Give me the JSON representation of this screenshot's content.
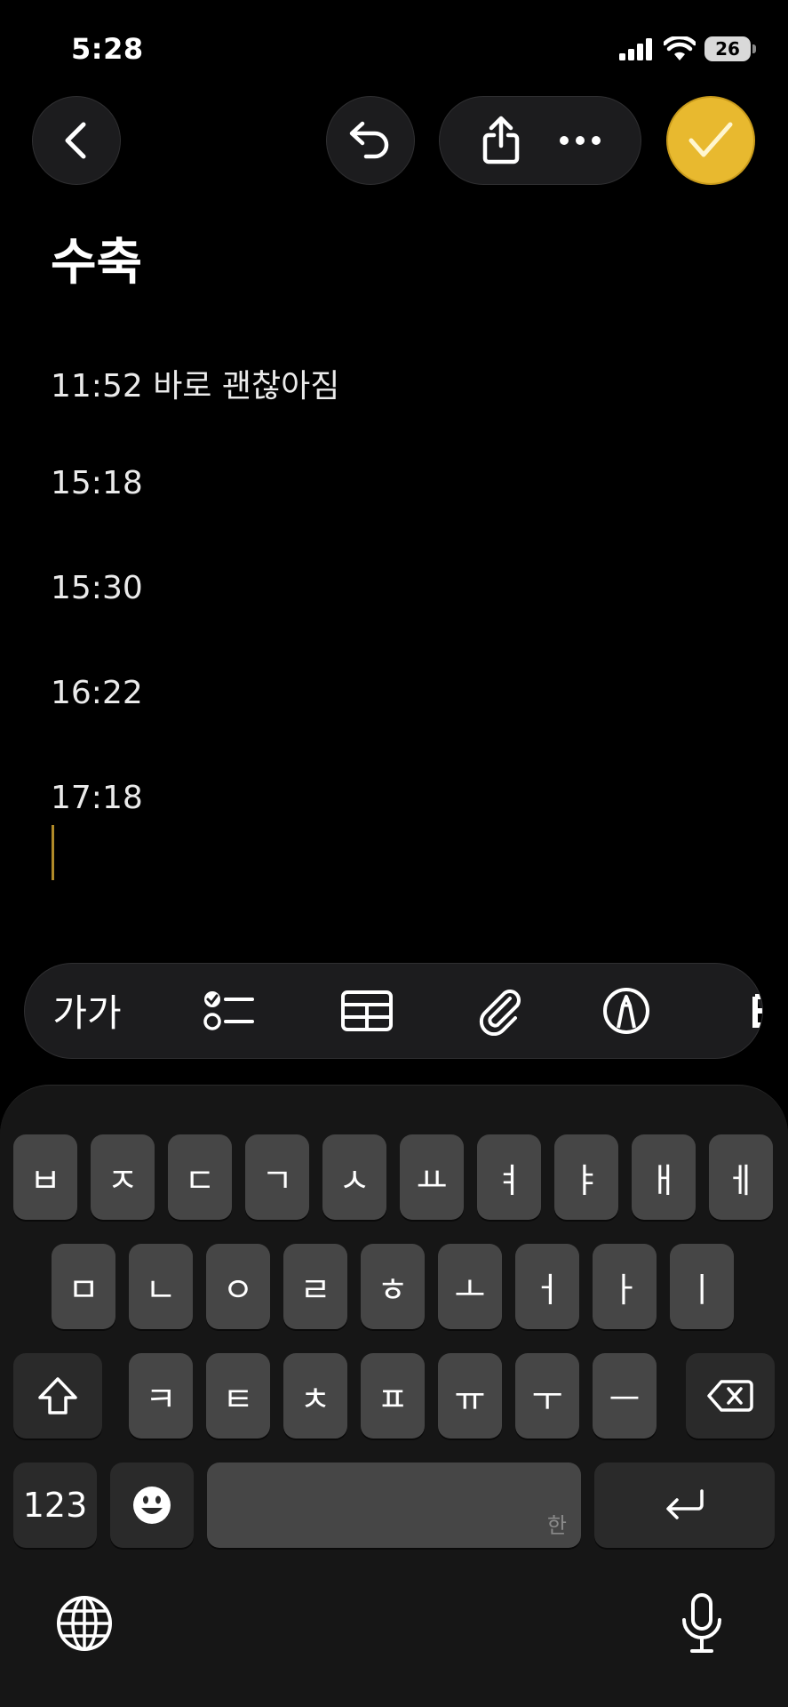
{
  "status": {
    "time": "5:28",
    "battery": "26"
  },
  "nav": {
    "back_icon": "chevron-left-icon",
    "undo_icon": "undo-icon",
    "share_icon": "share-icon",
    "more_icon": "ellipsis-icon",
    "done_icon": "checkmark-icon",
    "done_color": "#e8b92f"
  },
  "note": {
    "title": "수축",
    "lines": [
      "11:52 바로 괜찮아짐",
      "15:18",
      "15:30",
      "16:22",
      "17:18"
    ]
  },
  "toolbar": {
    "format_label": "가가",
    "items": [
      "format",
      "checklist-icon",
      "table-icon",
      "attachment-icon",
      "markup-icon",
      "apple-intelligence-icon"
    ]
  },
  "keyboard": {
    "row1": [
      "ㅂ",
      "ㅈ",
      "ㄷ",
      "ㄱ",
      "ㅅ",
      "ㅛ",
      "ㅕ",
      "ㅑ",
      "ㅐ",
      "ㅔ"
    ],
    "row2": [
      "ㅁ",
      "ㄴ",
      "ㅇ",
      "ㄹ",
      "ㅎ",
      "ㅗ",
      "ㅓ",
      "ㅏ",
      "ㅣ"
    ],
    "row3": [
      "ㅋ",
      "ㅌ",
      "ㅊ",
      "ㅍ",
      "ㅠ",
      "ㅜ",
      "ㅡ"
    ],
    "numbers_label": "123",
    "space_hint": "한",
    "shift_icon": "shift-icon",
    "delete_icon": "delete-icon",
    "emoji_icon": "emoji-icon",
    "return_icon": "return-icon",
    "globe_icon": "globe-icon",
    "mic_icon": "microphone-icon"
  }
}
